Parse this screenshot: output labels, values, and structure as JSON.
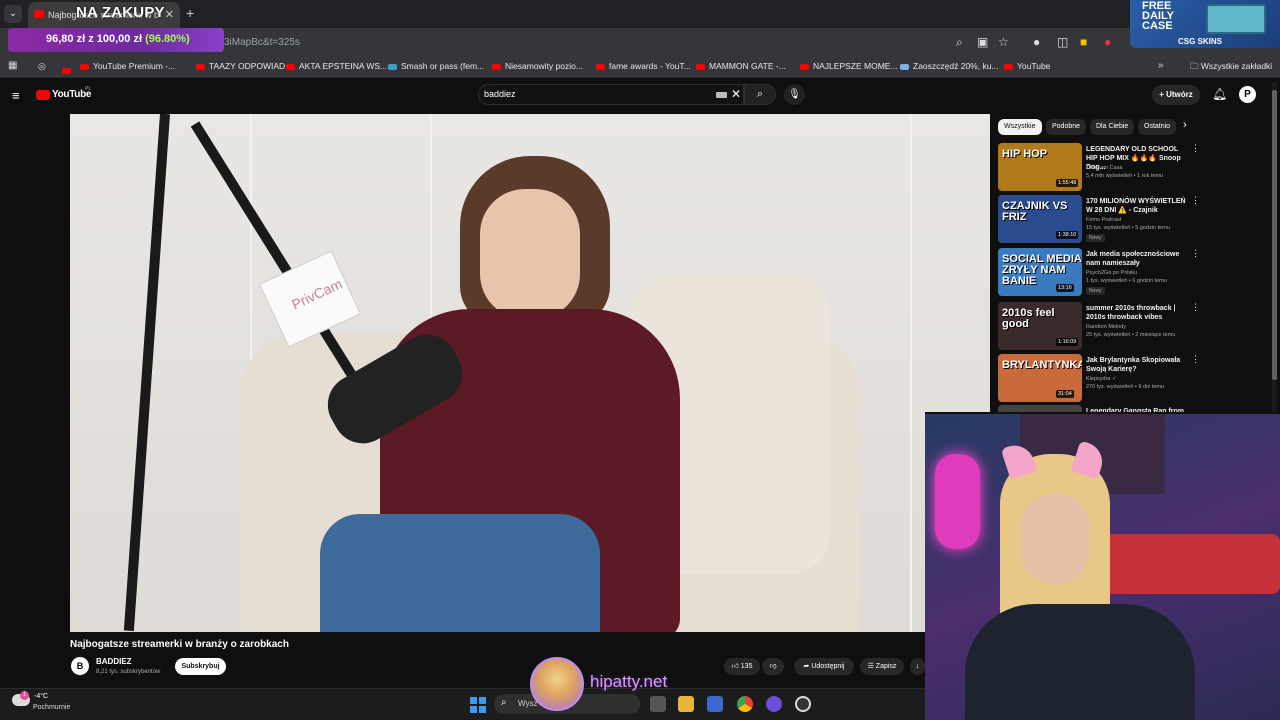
{
  "browser": {
    "tab_title": "Najbogatsze streamerki w branży o zarobkach",
    "overlay_title": "NA ZAKUPY",
    "url_tail": "3iMapBc&t=325s",
    "progress": {
      "text": "96,80 zł z 100,00 zł",
      "percent_label": "(96.80%)",
      "fraction": 0.968
    },
    "ad": {
      "line1": "FREE",
      "line2": "DAILY",
      "line3": "CASE",
      "brand": "CSG SKINS"
    }
  },
  "bookmarks": [
    {
      "label": "YouTube Premium -...",
      "icon": "youtube-icon"
    },
    {
      "label": "TAAZY ODPOWIAD...",
      "icon": "youtube-icon"
    },
    {
      "label": "AKTA EPSTEINA WS...",
      "icon": "youtube-icon"
    },
    {
      "label": "Smash or pass (fem...",
      "icon": "page-icon"
    },
    {
      "label": "Niesamowity pozio...",
      "icon": "youtube-icon"
    },
    {
      "label": "fame awards - YouT...",
      "icon": "youtube-icon"
    },
    {
      "label": "MAMMON GATE -...",
      "icon": "youtube-icon"
    },
    {
      "label": "NAJLEPSZE MOME...",
      "icon": "youtube-icon"
    },
    {
      "label": "Zaoszczędź 20%, ku...",
      "icon": "tag-icon"
    },
    {
      "label": "YouTube",
      "icon": "youtube-icon"
    }
  ],
  "bookmarks_all_label": "Wszystkie zakładki",
  "youtube": {
    "logo": "YouTube",
    "region": "PL",
    "search_value": "baddiez",
    "create_label": "Utwórz",
    "avatar_letter": "P",
    "video": {
      "title": "Najbogatsze streamerki w branży o zarobkach",
      "mic_brand": "PrivCam",
      "channel": "BADDIEZ",
      "subscribers": "8,21 tys. subskrybentów",
      "subscribe_label": "Subskrybuj",
      "likes": "135",
      "share_label": "Udostępnij",
      "save_label": "Zapisz"
    },
    "chips": [
      "Wszystkie",
      "Podobne",
      "Dla Ciebie",
      "Ostatnio"
    ],
    "recommendations": [
      {
        "thumb_text": "HIP HOP",
        "thumb_color": "#b07a1a",
        "duration": "1:55:48",
        "title": "LEGENDARY OLD SCHOOL HIP HOP MIX 🔥🔥🔥 Snoop Dog...",
        "channel": "Deus em Casa",
        "meta": "5,4 mln wyświetleń • 1 rok temu",
        "badge": ""
      },
      {
        "thumb_text": "CZAJNIK VS FRIZ",
        "thumb_color": "#2a4b8d",
        "duration": "1:38:10",
        "title": "170 MILIONÓW WYŚWIETLEŃ W 28 DNI ⚠️ - Czajnik",
        "channel": "Fomo Podcast",
        "meta": "15 tys. wyświetleń • 5 godzin temu",
        "badge": "Nowy"
      },
      {
        "thumb_text": "SOCIAL MEDIA ZRYŁY NAM BANIE",
        "thumb_color": "#3a7bbf",
        "duration": "13:16",
        "title": "Jak media społecznościowe nam namieszały",
        "channel": "Psych2Go po Polsku",
        "meta": "1 tys. wyświetleń • 6 godzin temu",
        "badge": "Nowy"
      },
      {
        "thumb_text": "2010s feel good",
        "thumb_color": "#3a2a2a",
        "duration": "1:16:09",
        "title": "summer 2010s throwback | 2010s throwback vibes",
        "channel": "Random Melody",
        "meta": "20 tys. wyświetleń • 2 miesiące temu",
        "badge": ""
      },
      {
        "thumb_text": "BRYLANTYNKA",
        "thumb_color": "#c86a3a",
        "duration": "31:04",
        "title": "Jak Brylantynka Skopiowała Swoją Karierę?",
        "channel": "Klepsydra ✓",
        "meta": "270 tys. wyświetleń • 9 dni temu",
        "badge": ""
      },
      {
        "thumb_text": "",
        "thumb_color": "#444444",
        "duration": "",
        "title": "Legendary Gangsta Rap from",
        "channel": "",
        "meta": "",
        "badge": ""
      }
    ]
  },
  "taskbar": {
    "temperature": "-4°C",
    "condition": "Pochmurnie",
    "weather_badge": "1",
    "search_text": "Wysz",
    "overlay_site": "hipatty.net"
  },
  "colors": {
    "accent_youtube": "#ff0000",
    "progress_green": "#9dff49",
    "overlay_purple": "#d59bff"
  }
}
